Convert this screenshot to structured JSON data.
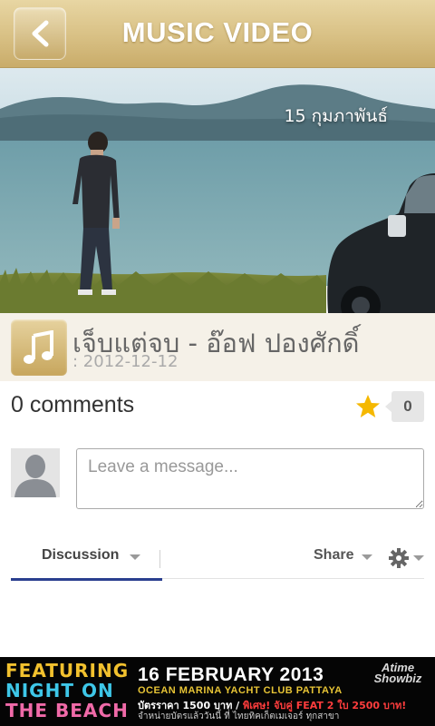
{
  "header": {
    "title": "MUSIC VIDEO",
    "back_icon": "chevron-left-icon"
  },
  "hero": {
    "date_text": "15 กุมภาพันธ์"
  },
  "track": {
    "icon": "music-note-icon",
    "title": "เจ็บแต่จบ - อ๊อฟ ปองศักดิ์",
    "date": ": 2012-12-12"
  },
  "comments": {
    "count_label": "0 comments",
    "star_icon": "star-icon",
    "star_count": "0",
    "input_placeholder": "Leave a message..."
  },
  "tabs": {
    "discussion": "Discussion",
    "share": "Share",
    "active_color": "#2a3f8f"
  },
  "ad": {
    "left_lines": [
      "FEATURING",
      "NIGHT ON",
      "THE BEACH"
    ],
    "date": "16 FEBRUARY 2013",
    "venue": "OCEAN MARINA YACHT CLUB PATTAYA",
    "price_a": "บัตรราคา 1500 บาท / ",
    "price_b": "พิเศษ! จับคู่ FEAT 2 ใบ 2500 บาท!",
    "sales": "จำหน่ายบัตรแล้ววันนี้ ที่ ไทยทิคเก็ตเมเจอร์ ทุกสาขา",
    "logo_line1": "Atime",
    "logo_line2": "Showbiz"
  },
  "colors": {
    "header_gold": "#d8c084",
    "track_bg": "#f5f1e8",
    "star": "#f5b800"
  }
}
